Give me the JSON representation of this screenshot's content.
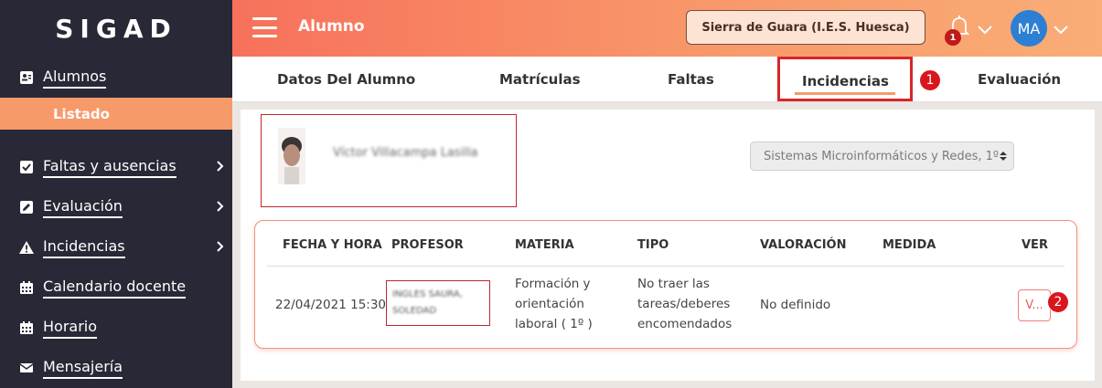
{
  "app": {
    "logo": "SIGAD"
  },
  "sidebar": {
    "items": [
      {
        "label": "Alumnos",
        "icon": "id-card-icon"
      },
      {
        "label": "Faltas y ausencias",
        "icon": "checkbox-icon"
      },
      {
        "label": "Evaluación",
        "icon": "edit-icon"
      },
      {
        "label": "Incidencias",
        "icon": "warning-icon"
      },
      {
        "label": "Calendario docente",
        "icon": "calendar-icon"
      },
      {
        "label": "Horario",
        "icon": "calendar-icon"
      },
      {
        "label": "Mensajería",
        "icon": "envelope-icon"
      }
    ],
    "active_sub": "Listado"
  },
  "header": {
    "title": "Alumno",
    "center": "Sierra de Guara (I.E.S. Huesca)",
    "notification_count": "1",
    "avatar_initials": "MA"
  },
  "tabs": [
    {
      "label": "Datos Del Alumno"
    },
    {
      "label": "Matrículas"
    },
    {
      "label": "Faltas"
    },
    {
      "label": "Incidencias",
      "active": true
    },
    {
      "label": "Evaluación"
    }
  ],
  "markers": {
    "m1": "1",
    "m2": "2"
  },
  "student": {
    "name": "Víctor Villacampa Lasilla",
    "course_select": "Sistemas Microinformáticos y Redes, 1º"
  },
  "table": {
    "headers": [
      "FECHA Y HORA",
      "PROFESOR",
      "MATERIA",
      "TIPO",
      "VALORACIÓN",
      "MEDIDA",
      "VER"
    ],
    "rows": [
      {
        "fecha": "22/04/2021 15:30",
        "profesor_line1": "INGLES SAURA,",
        "profesor_line2": "SOLEDAD",
        "materia_line1": "Formación y",
        "materia_line2": "orientación",
        "materia_line3": "laboral ( 1º )",
        "tipo_line1": "No traer las",
        "tipo_line2": "tareas/deberes",
        "tipo_line3": "encomendados",
        "valoracion": "No definido",
        "medida": "",
        "ver": "V..."
      }
    ]
  },
  "colors": {
    "accent": "#f79a6a",
    "sidebar": "#282836",
    "highlight": "#d9252a"
  }
}
